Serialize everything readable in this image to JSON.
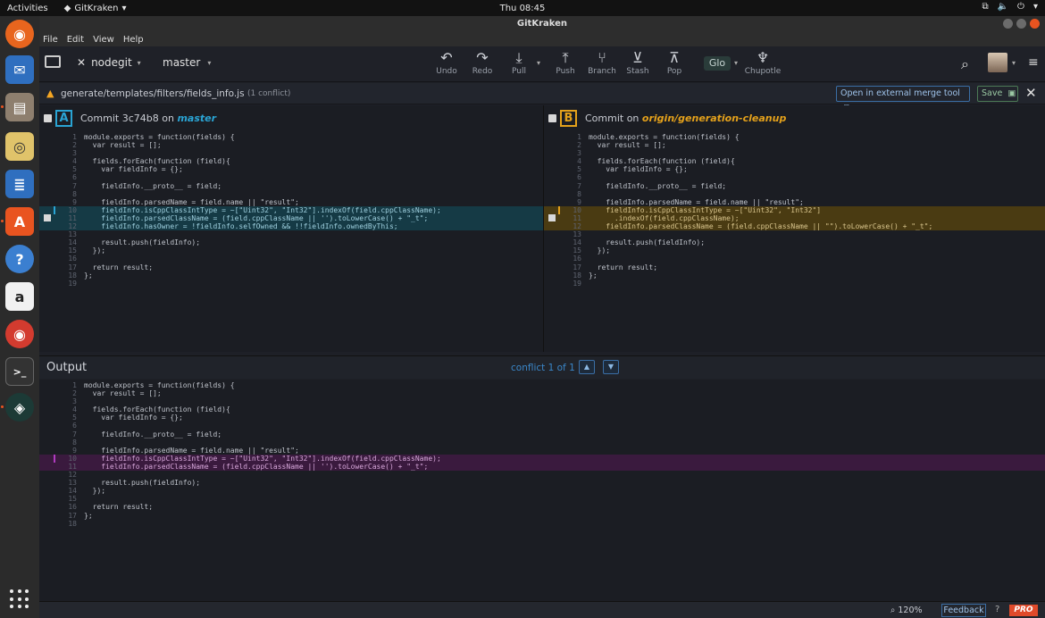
{
  "system_bar": {
    "activities": "Activities",
    "app_name": "GitKraken",
    "clock": "Thu 08:45"
  },
  "window": {
    "title": "GitKraken",
    "menu": [
      "File",
      "Edit",
      "View",
      "Help"
    ]
  },
  "toolbar": {
    "repo": "nodegit",
    "branch": "master",
    "buttons": {
      "undo": "Undo",
      "redo": "Redo",
      "pull": "Pull",
      "push": "Push",
      "branch": "Branch",
      "stash": "Stash",
      "pop": "Pop",
      "glo": "Glo",
      "chupotle": "Chupotle"
    }
  },
  "conflict_bar": {
    "file_path": "generate/templates/filters/fields_info.js",
    "conflict_count": "(1 conflict)",
    "external_button": "Open in external merge tool",
    "save_button": "Save"
  },
  "pane_a": {
    "letter": "A",
    "prefix": "Commit 3c74b8 on",
    "branch": "master",
    "accent_color": "#2aa4d4"
  },
  "pane_b": {
    "letter": "B",
    "prefix": "Commit on",
    "branch": "origin/generation-cleanup",
    "accent_color": "#e4a11b"
  },
  "code_a": [
    {
      "n": "1",
      "t": "module.exports = function(fields) {"
    },
    {
      "n": "2",
      "t": "  var result = [];"
    },
    {
      "n": "3",
      "t": ""
    },
    {
      "n": "4",
      "t": "  fields.forEach(function (field){"
    },
    {
      "n": "5",
      "t": "    var fieldInfo = {};"
    },
    {
      "n": "6",
      "t": ""
    },
    {
      "n": "7",
      "t": "    fieldInfo.__proto__ = field;"
    },
    {
      "n": "8",
      "t": ""
    },
    {
      "n": "9",
      "t": "    fieldInfo.parsedName = field.name || \"result\";"
    },
    {
      "n": "10",
      "t": "    fieldInfo.isCppClassIntType = ~[\"Uint32\", \"Int32\"].indexOf(field.cppClassName);"
    },
    {
      "n": "11",
      "t": "    fieldInfo.parsedClassName = (field.cppClassName || '').toLowerCase() + \"_t\";"
    },
    {
      "n": "12",
      "t": "    fieldInfo.hasOwner = !fieldInfo.selfOwned && !!fieldInfo.ownedByThis;"
    },
    {
      "n": "13",
      "t": ""
    },
    {
      "n": "14",
      "t": "    result.push(fieldInfo);"
    },
    {
      "n": "15",
      "t": "  });"
    },
    {
      "n": "16",
      "t": ""
    },
    {
      "n": "17",
      "t": "  return result;"
    },
    {
      "n": "18",
      "t": "};"
    },
    {
      "n": "19",
      "t": ""
    }
  ],
  "code_b": [
    {
      "n": "1",
      "t": "module.exports = function(fields) {"
    },
    {
      "n": "2",
      "t": "  var result = [];"
    },
    {
      "n": "3",
      "t": ""
    },
    {
      "n": "4",
      "t": "  fields.forEach(function (field){"
    },
    {
      "n": "5",
      "t": "    var fieldInfo = {};"
    },
    {
      "n": "6",
      "t": ""
    },
    {
      "n": "7",
      "t": "    fieldInfo.__proto__ = field;"
    },
    {
      "n": "8",
      "t": ""
    },
    {
      "n": "9",
      "t": "    fieldInfo.parsedName = field.name || \"result\";"
    },
    {
      "n": "10",
      "t": "    fieldInfo.isCppClassIntType = ~[\"Uint32\", \"Int32\"]"
    },
    {
      "n": "11",
      "t": "      .indexOf(field.cppClassName);"
    },
    {
      "n": "12",
      "t": "    fieldInfo.parsedClassName = (field.cppClassName || \"\").toLowerCase() + \"_t\";"
    },
    {
      "n": "13",
      "t": ""
    },
    {
      "n": "14",
      "t": "    result.push(fieldInfo);"
    },
    {
      "n": "15",
      "t": "  });"
    },
    {
      "n": "16",
      "t": ""
    },
    {
      "n": "17",
      "t": "  return result;"
    },
    {
      "n": "18",
      "t": "};"
    },
    {
      "n": "19",
      "t": ""
    }
  ],
  "output": {
    "title": "Output",
    "conflict_nav": "conflict 1 of 1",
    "code": [
      {
        "n": "1",
        "t": "module.exports = function(fields) {"
      },
      {
        "n": "2",
        "t": "  var result = [];"
      },
      {
        "n": "3",
        "t": ""
      },
      {
        "n": "4",
        "t": "  fields.forEach(function (field){"
      },
      {
        "n": "5",
        "t": "    var fieldInfo = {};"
      },
      {
        "n": "6",
        "t": ""
      },
      {
        "n": "7",
        "t": "    fieldInfo.__proto__ = field;"
      },
      {
        "n": "8",
        "t": ""
      },
      {
        "n": "9",
        "t": "    fieldInfo.parsedName = field.name || \"result\";"
      },
      {
        "n": "10",
        "t": "    fieldInfo.isCppClassIntType = ~[\"Uint32\", \"Int32\"].indexOf(field.cppClassName);"
      },
      {
        "n": "11",
        "t": "    fieldInfo.parsedClassName = (field.cppClassName || '').toLowerCase() + \"_t\";"
      },
      {
        "n": "12",
        "t": ""
      },
      {
        "n": "13",
        "t": "    result.push(fieldInfo);"
      },
      {
        "n": "14",
        "t": "  });"
      },
      {
        "n": "15",
        "t": ""
      },
      {
        "n": "16",
        "t": "  return result;"
      },
      {
        "n": "17",
        "t": "};"
      },
      {
        "n": "18",
        "t": ""
      }
    ]
  },
  "status_bar": {
    "zoom": "120%",
    "feedback": "Feedback",
    "pro": "PRO"
  },
  "dock": [
    "firefox-icon",
    "thunderbird-icon",
    "files-icon",
    "rhythmbox-icon",
    "writer-icon",
    "software-icon",
    "help-icon",
    "amazon-icon",
    "chrome-icon",
    "terminal-icon",
    "gitkraken-icon"
  ]
}
